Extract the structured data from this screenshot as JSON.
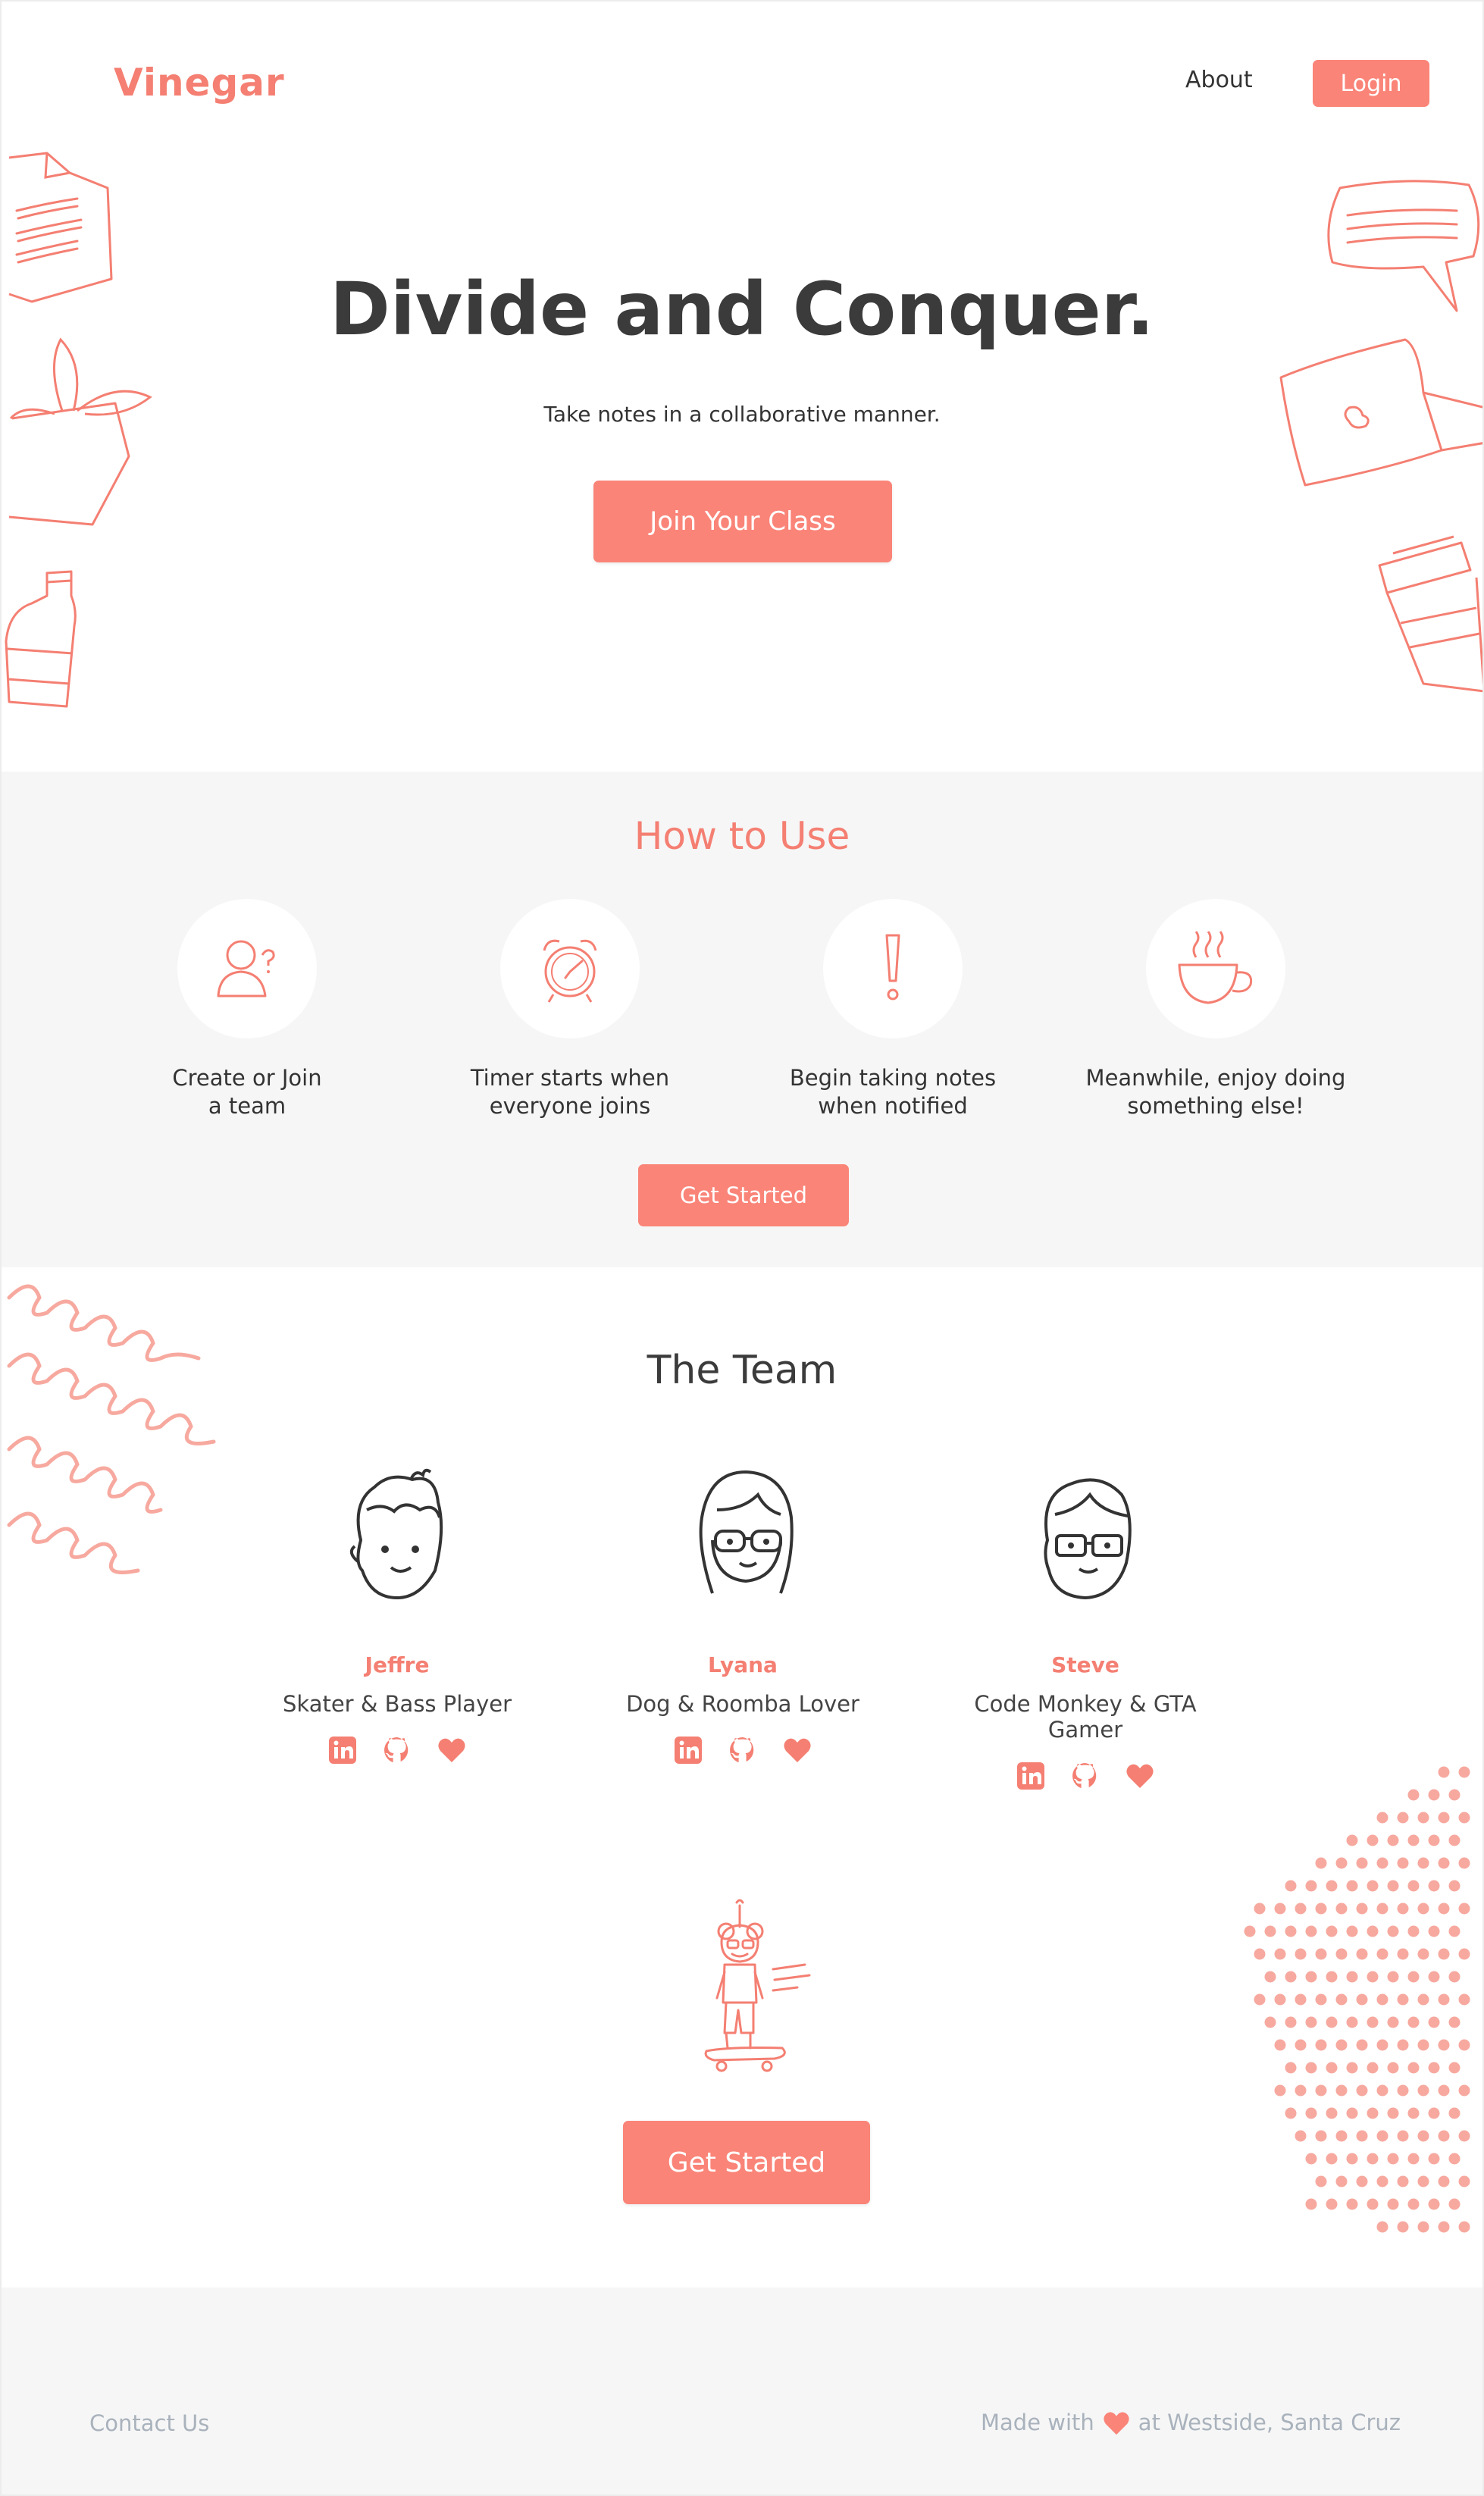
{
  "header": {
    "logo": "Vinegar",
    "nav_about": "About",
    "nav_login": "Login"
  },
  "hero": {
    "title": "Divide and Conquer.",
    "subtitle": "Take notes in a collaborative manner.",
    "button": "Join Your Class"
  },
  "howto": {
    "title": "How to Use",
    "steps": [
      {
        "icon": "person-question-icon",
        "label_1": "Create or Join",
        "label_2": "a team"
      },
      {
        "icon": "alarm-clock-icon",
        "label_1": "Timer starts when",
        "label_2": "everyone joins"
      },
      {
        "icon": "exclamation-icon",
        "label_1": "Begin taking notes",
        "label_2": "when notified"
      },
      {
        "icon": "coffee-cup-icon",
        "label_1": "Meanwhile, enjoy doing",
        "label_2": "something else!"
      }
    ],
    "button": "Get Started"
  },
  "team": {
    "title": "The Team",
    "members": [
      {
        "name": "Jeffre",
        "role": "Skater & Bass Player"
      },
      {
        "name": "Lyana",
        "role": "Dog & Roomba Lover"
      },
      {
        "name": "Steve",
        "role": "Code Monkey & GTA Gamer"
      }
    ],
    "link_icons": [
      "linkedin-icon",
      "github-icon",
      "heart-icon"
    ]
  },
  "cta": {
    "button": "Get Started"
  },
  "footer": {
    "contact": "Contact Us",
    "made_prefix": "Made with",
    "made_suffix": "at Westside, Santa Cruz"
  },
  "colors": {
    "accent": "#fa8478",
    "accent_text": "#f47f72",
    "section_bg": "#f6f6f6",
    "footer_text": "#a9b2bc"
  }
}
